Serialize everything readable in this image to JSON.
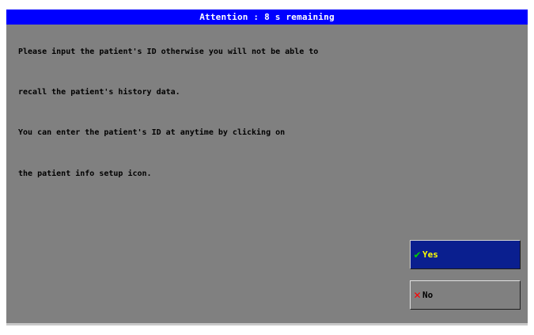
{
  "dialog": {
    "title": "Attention : 8 s remaining",
    "message_lines": [
      "Please input the patient's ID otherwise you will not be able to",
      "recall the patient's history data.",
      "You can enter the patient's ID at anytime by clicking on",
      "the patient info setup icon."
    ],
    "buttons": {
      "yes": {
        "label": "Yes",
        "icon": "check-icon"
      },
      "no": {
        "label": "No",
        "icon": "x-icon"
      }
    }
  },
  "colors": {
    "title_bar": "#0000ff",
    "dialog_bg": "#808080",
    "yes_bg": "#0a1f8f",
    "yes_text": "#ffff00",
    "check": "#00d000",
    "cross": "#ff0000"
  }
}
